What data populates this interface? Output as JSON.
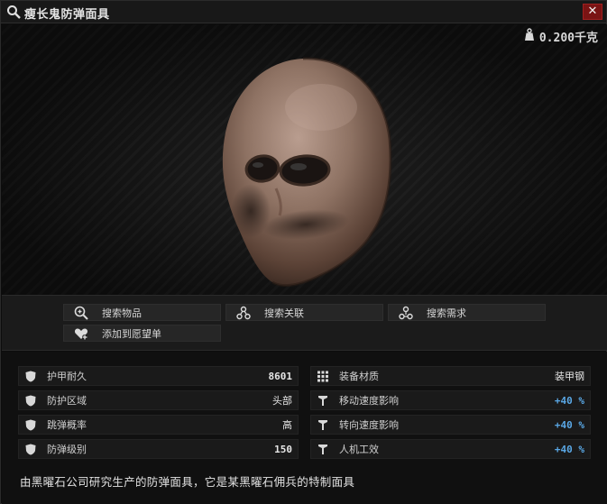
{
  "window": {
    "title": "瘦长鬼防弹面具",
    "close_label": "✕"
  },
  "preview": {
    "weight": "0.200千克",
    "weight_icon": "weight-icon",
    "item_image": "skull-mask"
  },
  "actions": [
    {
      "label": "搜索物品",
      "icon": "search-item-icon"
    },
    {
      "label": "搜索关联",
      "icon": "linked-search-icon"
    },
    {
      "label": "搜索需求",
      "icon": "required-search-icon"
    },
    {
      "label": "添加到愿望单",
      "icon": "wishlist-heart-icon"
    }
  ],
  "stats_left": [
    {
      "label": "护甲耐久",
      "value": "8601",
      "icon": "shield-icon"
    },
    {
      "label": "防护区域",
      "value": "头部",
      "icon": "shield-icon"
    },
    {
      "label": "跳弹概率",
      "value": "高",
      "icon": "shield-icon"
    },
    {
      "label": "防弹级别",
      "value": "150",
      "icon": "shield-icon"
    }
  ],
  "stats_right": [
    {
      "label": "装备材质",
      "value": "装甲钢",
      "icon": "grid-icon"
    },
    {
      "label": "移动速度影响",
      "value": "+40 %",
      "icon": "penalty-icon"
    },
    {
      "label": "转向速度影响",
      "value": "+40 %",
      "icon": "penalty-icon"
    },
    {
      "label": "人机工效",
      "value": "+40 %",
      "icon": "penalty-icon"
    }
  ],
  "description": "由黑曜石公司研究生产的防弹面具，它是某黑曜石佣兵的特制面具",
  "colors": {
    "close_bg": "#7a1414",
    "positive": "#5aa8e6",
    "panel": "#1a1a1a"
  }
}
